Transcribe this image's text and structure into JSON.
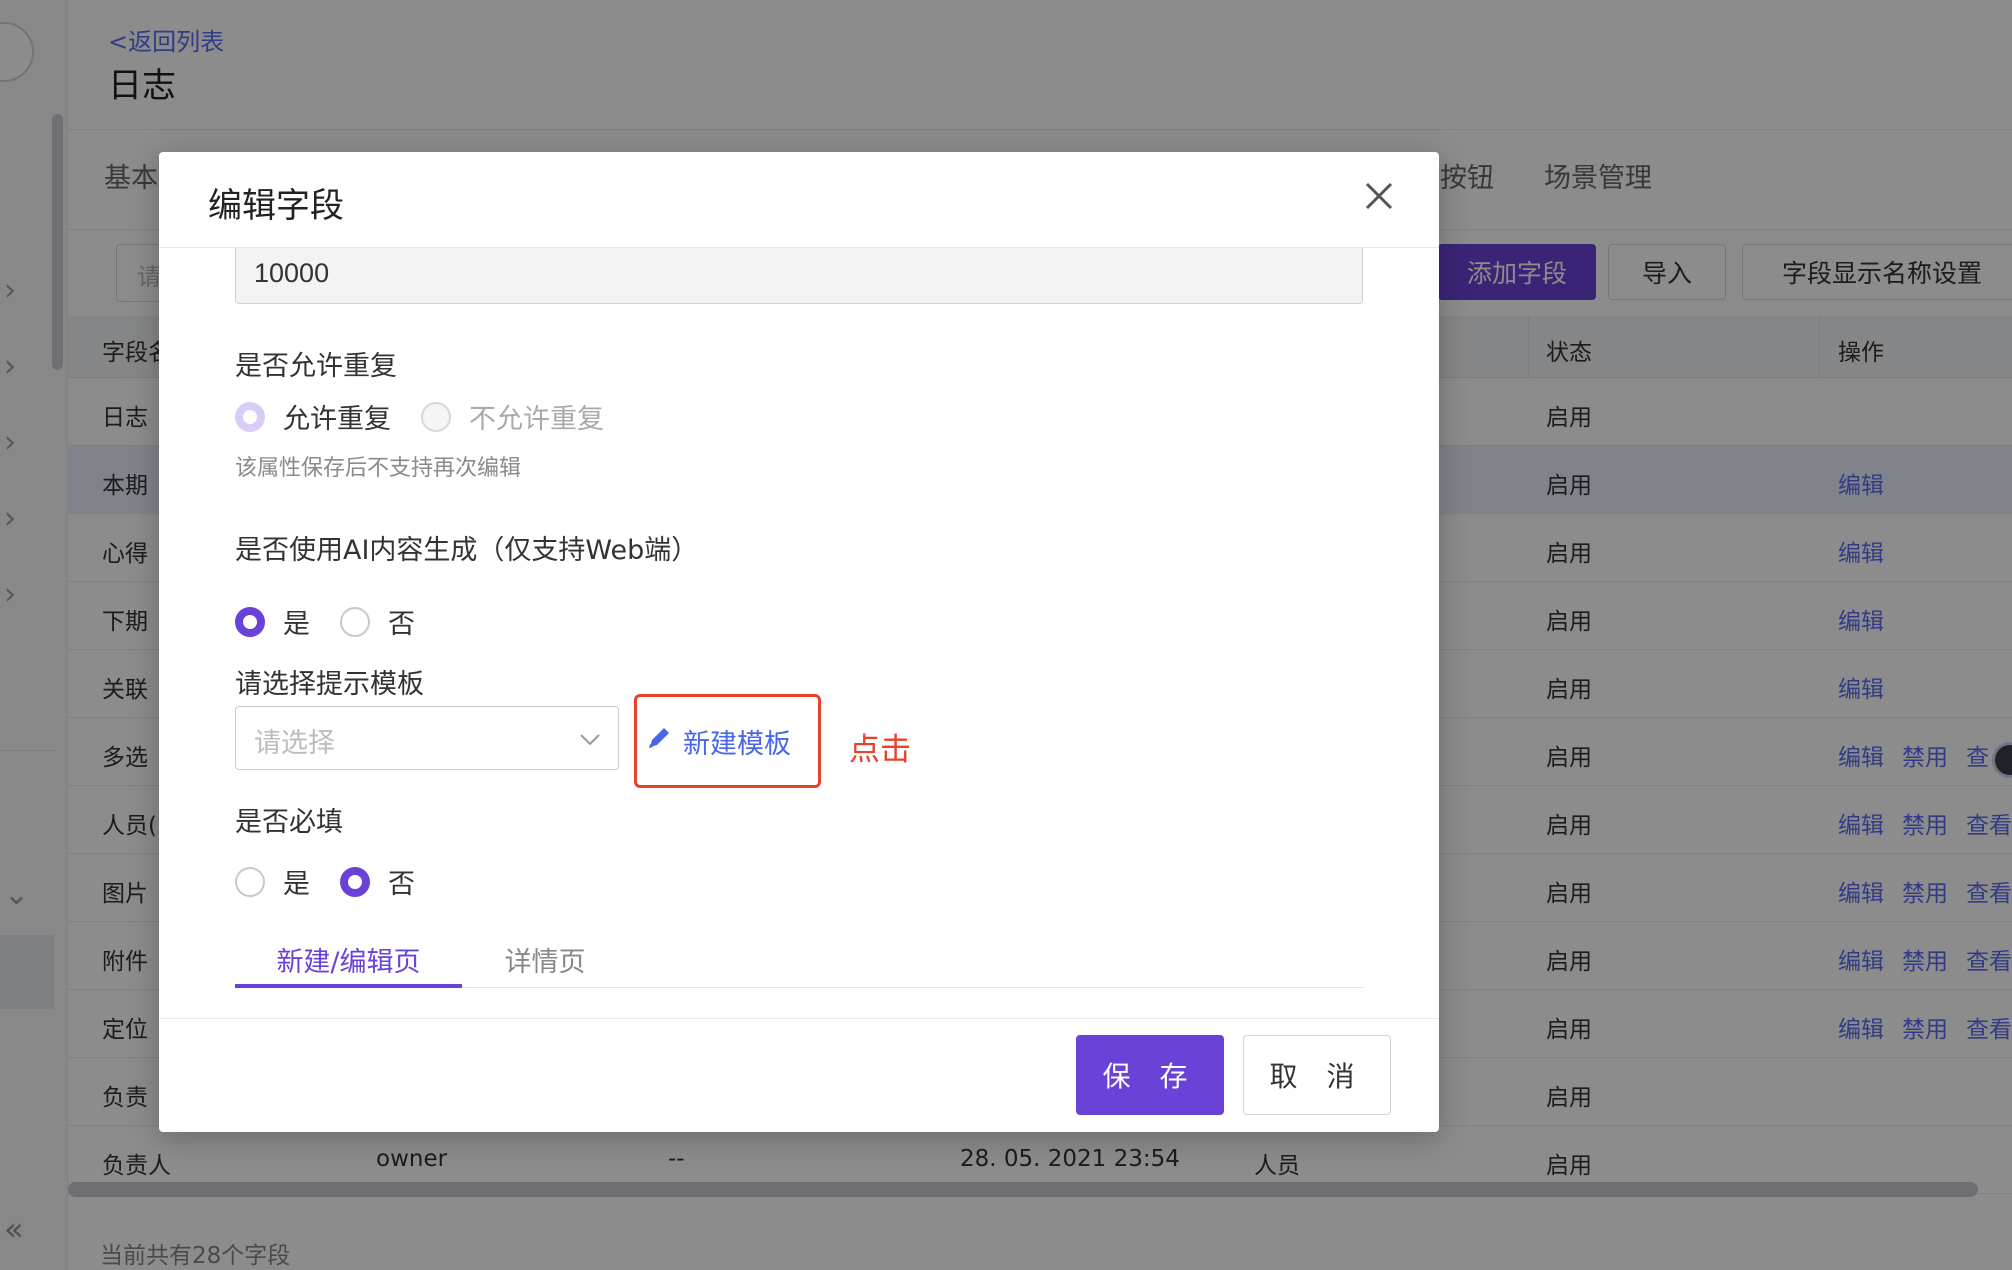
{
  "page": {
    "back_link": "<返回列表",
    "title": "日志",
    "tabs": [
      "基本",
      "按钮",
      "场景管理"
    ],
    "search_placeholder": "请",
    "toolbar": {
      "add_field": "添加字段",
      "import": "导入",
      "display_name_settings": "字段显示名称设置"
    },
    "table": {
      "headers": {
        "field_name": "字段名",
        "status": "状态",
        "actions": "操作"
      },
      "rows": [
        {
          "name": "日志",
          "status": "启用",
          "actions": []
        },
        {
          "name": "本期",
          "status": "启用",
          "actions": [
            "编辑"
          ]
        },
        {
          "name": "心得",
          "status": "启用",
          "actions": [
            "编辑"
          ]
        },
        {
          "name": "下期",
          "status": "启用",
          "actions": [
            "编辑"
          ]
        },
        {
          "name": "关联",
          "status": "启用",
          "actions": [
            "编辑"
          ]
        },
        {
          "name": "多选",
          "status": "启用",
          "actions": [
            "编辑",
            "禁用",
            "查"
          ]
        },
        {
          "name": "人员(",
          "status": "启用",
          "actions": [
            "编辑",
            "禁用",
            "查看"
          ]
        },
        {
          "name": "图片",
          "status": "启用",
          "actions": [
            "编辑",
            "禁用",
            "查看"
          ]
        },
        {
          "name": "附件",
          "status": "启用",
          "actions": [
            "编辑",
            "禁用",
            "查看"
          ]
        },
        {
          "name": "定位",
          "status": "启用",
          "actions": [
            "编辑",
            "禁用",
            "查看"
          ]
        },
        {
          "name": "负责",
          "status": "启用",
          "actions": []
        },
        {
          "name": "负责人",
          "api": "owner",
          "default": "--",
          "time": "28. 05. 2021 23:54",
          "type": "人员",
          "status": "启用",
          "actions": []
        }
      ]
    },
    "footer_count": "当前共有28个字段"
  },
  "modal": {
    "title": "编辑字段",
    "number_value": "10000",
    "allow_duplicate": {
      "label": "是否允许重复",
      "options": [
        "允许重复",
        "不允许重复"
      ],
      "hint": "该属性保存后不支持再次编辑"
    },
    "ai_generate": {
      "label": "是否使用AI内容生成（仅支持Web端）",
      "options": [
        "是",
        "否"
      ]
    },
    "template": {
      "label": "请选择提示模板",
      "placeholder": "请选择",
      "new_template": "新建模板",
      "annotation": "点击"
    },
    "required": {
      "label": "是否必填",
      "options": [
        "是",
        "否"
      ]
    },
    "sub_tabs": [
      "新建/编辑页",
      "详情页"
    ],
    "buttons": {
      "save": "保 存",
      "cancel": "取 消"
    }
  },
  "colors": {
    "accent": "#6b42d8",
    "link": "#4a66e8",
    "annotation": "#e8412c"
  }
}
